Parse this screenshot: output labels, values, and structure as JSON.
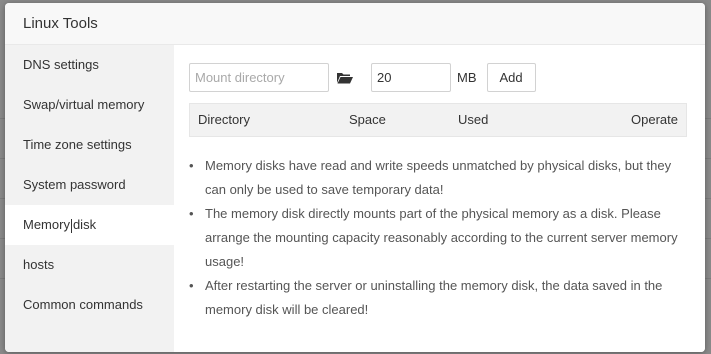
{
  "dialog": {
    "title": "Linux Tools"
  },
  "sidebar": {
    "items": [
      {
        "label": "DNS settings"
      },
      {
        "label": "Swap/virtual memory"
      },
      {
        "label": "Time zone settings"
      },
      {
        "label": "System password"
      },
      {
        "label_part1": "Memory",
        "label_part2": "disk"
      },
      {
        "label": "hosts"
      },
      {
        "label": "Common commands"
      }
    ]
  },
  "toolbar": {
    "mount_placeholder": "Mount directory",
    "folder_icon": "folder-open-icon",
    "size_value": "20",
    "unit": "MB",
    "add_label": "Add"
  },
  "table": {
    "headers": [
      "Directory",
      "Space",
      "Used",
      "Operate"
    ]
  },
  "notes": {
    "bullet": "•",
    "items": [
      "Memory disks have read and write speeds unmatched by physical disks, but they can only be used to save temporary data!",
      "The memory disk directly mounts part of the physical memory as a disk. Please arrange the mounting capacity reasonably according to the current server memory usage!",
      "After restarting the server or uninstalling the memory disk, the data saved in the memory disk will be cleared!"
    ]
  },
  "colors": {
    "sidebar_bg": "#f2f2f2",
    "titlebar_bg": "#f8f8f8",
    "table_head_bg": "#f2f2f2"
  }
}
